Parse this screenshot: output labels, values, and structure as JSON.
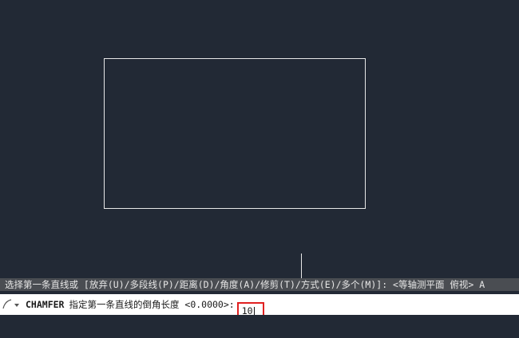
{
  "history": {
    "text": "选择第一条直线或 [放弃(U)/多段线(P)/距离(D)/角度(A)/修剪(T)/方式(E)/多个(M)]: <等轴测平面 俯视> A"
  },
  "command": {
    "icon": "command-line-icon",
    "name": "CHAMFER",
    "prompt": "指定第一条直线的倒角长度 <0.0000>:",
    "input_value": "10"
  },
  "colors": {
    "background": "#222935",
    "history_bar": "#4a4d52",
    "input_highlight": "#e02020"
  }
}
